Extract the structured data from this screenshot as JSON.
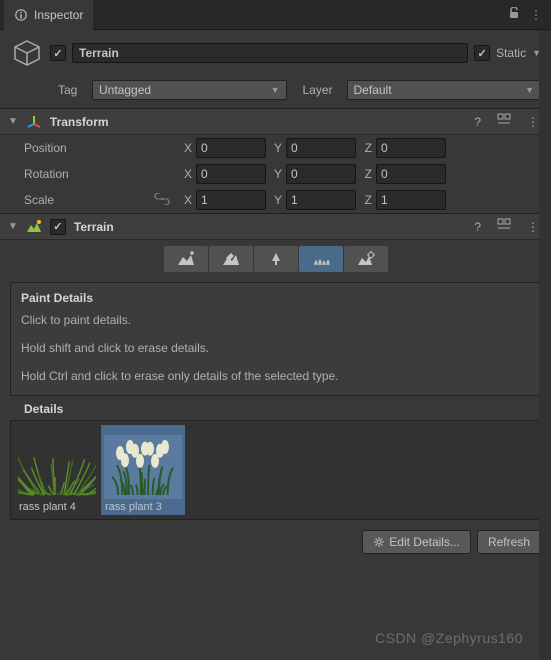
{
  "tab": {
    "title": "Inspector"
  },
  "header": {
    "name": "Terrain",
    "static_label": "Static",
    "tag_label": "Tag",
    "tag_value": "Untagged",
    "layer_label": "Layer",
    "layer_value": "Default"
  },
  "transform": {
    "title": "Transform",
    "position_label": "Position",
    "rotation_label": "Rotation",
    "scale_label": "Scale",
    "x": "X",
    "y": "Y",
    "z": "Z",
    "position": {
      "x": "0",
      "y": "0",
      "z": "0"
    },
    "rotation": {
      "x": "0",
      "y": "0",
      "z": "0"
    },
    "scale": {
      "x": "1",
      "y": "1",
      "z": "1"
    }
  },
  "terrain": {
    "title": "Terrain",
    "tools": [
      "raise-lower",
      "paint-texture",
      "paint-trees",
      "paint-details",
      "settings"
    ],
    "active_tool_index": 3,
    "paint_panel": {
      "title": "Paint Details",
      "line1": "Click to paint details.",
      "line2": "Hold shift and click to erase details.",
      "line3": "Hold Ctrl and click to erase only details of the selected type."
    },
    "details_label": "Details",
    "details": [
      {
        "name": "rass plant 4",
        "selected": false,
        "color_a": "#5a8a2a",
        "color_b": "#3a6a1a"
      },
      {
        "name": "rass plant 3",
        "selected": true,
        "color_a": "#2a5a2a",
        "color_b": "#e8e8d0"
      }
    ],
    "buttons": {
      "edit": "Edit Details...",
      "refresh": "Refresh"
    }
  },
  "watermark": "CSDN @Zephyrus160"
}
